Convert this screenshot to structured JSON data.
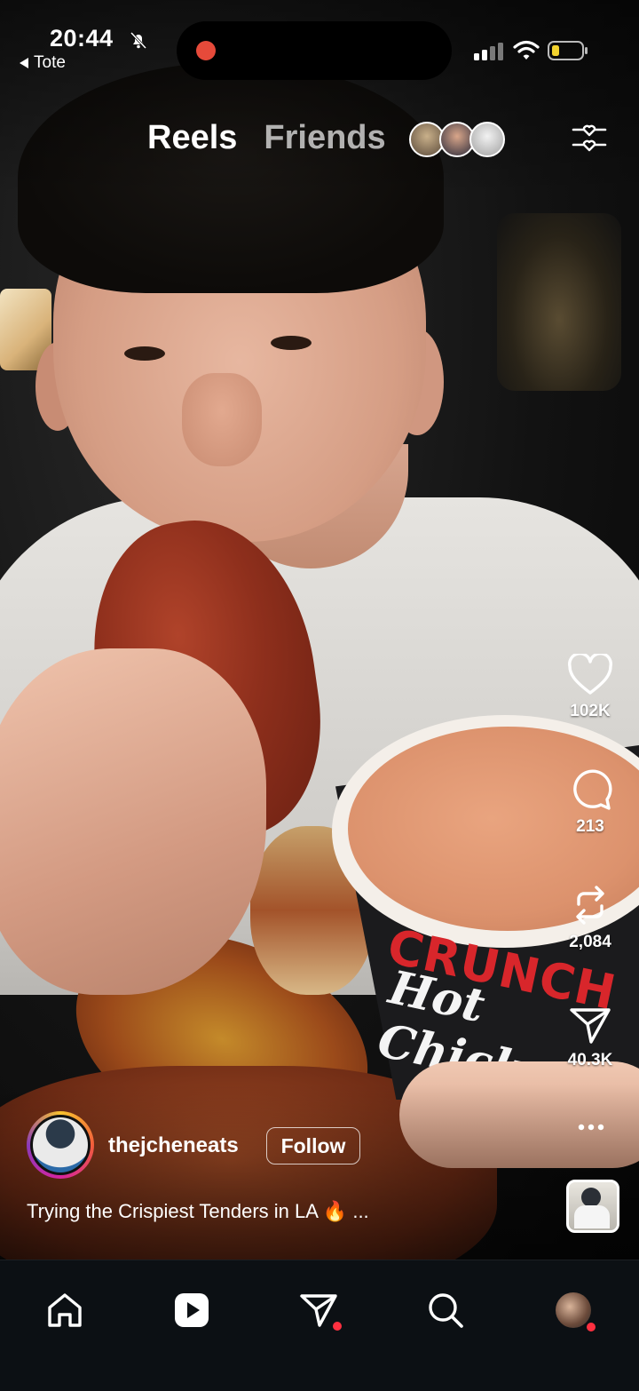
{
  "status_bar": {
    "time": "20:44",
    "back_app": "Tote",
    "icons": [
      "bell-slash-icon",
      "signal-icon",
      "wifi-icon",
      "battery-icon"
    ],
    "recording_indicator_color": "#e64a3a",
    "battery_color": "#f2d22e"
  },
  "header": {
    "tabs": [
      {
        "label": "Reels",
        "active": true
      },
      {
        "label": "Friends",
        "active": false
      }
    ],
    "friend_avatar_count": 3,
    "filter_icon": "sliders-heart-icon"
  },
  "actions": {
    "like_count": "102K",
    "comment_count": "213",
    "repost_count": "2,084",
    "share_count": "40.3K",
    "icons": [
      "heart-icon",
      "comment-icon",
      "repost-icon",
      "send-icon",
      "more-icon"
    ]
  },
  "author": {
    "username": "thejcheneats",
    "follow_label": "Follow"
  },
  "caption": {
    "text": "Trying the Crispiest Tenders in LA 🔥 ..."
  },
  "video_overlay": {
    "cup_text_top": "CRUNCH",
    "cup_text_bottom": "Hot Chick"
  },
  "bottom_nav": {
    "items": [
      "home-icon",
      "reels-icon",
      "messages-icon",
      "search-icon",
      "profile-avatar"
    ],
    "active": "reels-icon",
    "notification_color": "#ff3040"
  }
}
